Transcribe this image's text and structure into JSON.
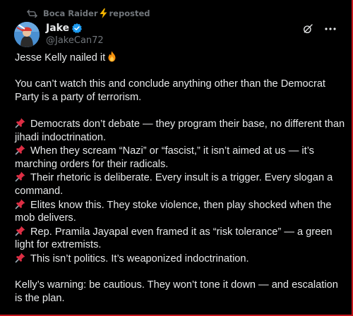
{
  "repost": {
    "author": "Boca Raider",
    "action": "reposted"
  },
  "author": {
    "name": "Jake",
    "handle": "@JakeCan72"
  },
  "tweet": {
    "line1": "Jesse Kelly nailed it",
    "para2": "You can’t watch this and conclude anything other than the Democrat Party is a party of terrorism.",
    "bullets": [
      "Democrats don’t debate — they program their base, no different than jihadi indoctrination.",
      "When they scream “Nazi” or “fascist,” it isn’t aimed at us — it’s marching orders for their radicals.",
      "Their rhetoric is deliberate. Every insult is a trigger. Every slogan a command.",
      "Elites know this. They stoke violence, then play shocked when the mob delivers.",
      "Rep. Pramila Jayapal even framed it as “risk tolerance” — a green light for extremists.",
      "This isn’t politics. It’s weaponized indoctrination."
    ],
    "closing": "Kelly’s warning: be cautious. They won’t tone it down — and escalation is the plan."
  },
  "icons": {
    "repost": "repost-icon",
    "bolt": "lightning-bolt-icon",
    "verified": "verified-badge-icon",
    "grok": "grok-icon",
    "more": "more-options-icon",
    "pin": "pushpin-emoji-icon",
    "fire": "fire-emoji-icon"
  },
  "colors": {
    "background": "#000000",
    "text": "#e7e9ea",
    "muted": "#71767b",
    "verified": "#1d9bf0",
    "frame": "#c4151c"
  }
}
